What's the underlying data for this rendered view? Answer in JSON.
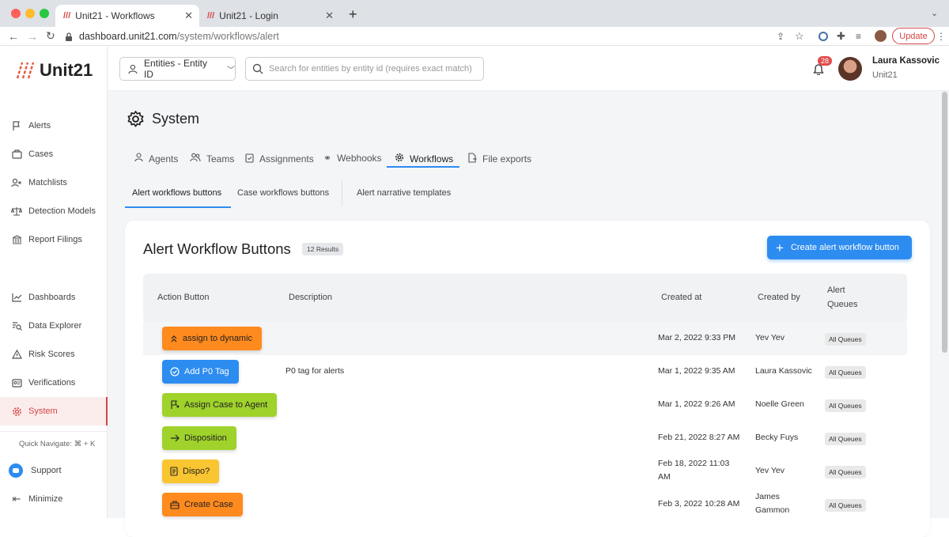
{
  "colors": {
    "accent": "#2d8cf0",
    "brand": "#d64545",
    "orange": "#ff8a1e",
    "blue": "#2d8cf0",
    "green": "#9fd22b",
    "yellow": "#f9c531"
  },
  "browser": {
    "tabs": [
      {
        "title": "Unit21 - Workflows",
        "active": true
      },
      {
        "title": "Unit21 - Login",
        "active": false
      }
    ],
    "url_host": "dashboard.unit21.com",
    "url_path": "/system/workflows/alert",
    "update_label": "Update"
  },
  "sidebar": {
    "logo": "Unit21",
    "items": [
      {
        "label": "Alerts",
        "icon": "flag-icon"
      },
      {
        "label": "Cases",
        "icon": "briefcase-icon"
      },
      {
        "label": "Matchlists",
        "icon": "user-plus-icon"
      },
      {
        "label": "Detection Models",
        "icon": "scale-icon"
      },
      {
        "label": "Report Filings",
        "icon": "bank-icon"
      },
      {
        "label": "Dashboards",
        "icon": "chart-line-icon"
      },
      {
        "label": "Data Explorer",
        "icon": "search-doc-icon"
      },
      {
        "label": "Risk Scores",
        "icon": "warning-icon"
      },
      {
        "label": "Verifications",
        "icon": "id-card-icon"
      },
      {
        "label": "System",
        "icon": "gear-icon",
        "active": true
      }
    ],
    "quick_navigate": "Quick Navigate: ⌘ + K",
    "support": "Support",
    "minimize": "Minimize"
  },
  "topbar": {
    "entity_selector": "Entities - Entity ID",
    "search_placeholder": "Search for entities by entity id (requires exact match)",
    "notification_count": "28",
    "user_name": "Laura Kassovic",
    "user_org": "Unit21"
  },
  "page": {
    "title": "System",
    "tabs": [
      {
        "label": "Agents"
      },
      {
        "label": "Teams"
      },
      {
        "label": "Assignments"
      },
      {
        "label": "Webhooks"
      },
      {
        "label": "Workflows",
        "active": true
      },
      {
        "label": "File exports"
      }
    ],
    "subtabs": [
      {
        "label": "Alert workflows buttons",
        "active": true
      },
      {
        "label": "Case workflows buttons"
      },
      {
        "label": "Alert narrative templates"
      }
    ]
  },
  "card": {
    "title": "Alert Workflow Buttons",
    "results": "12 Results",
    "create_label": "Create alert workflow button",
    "columns": {
      "action": "Action Button",
      "description": "Description",
      "created_at": "Created at",
      "created_by": "Created by",
      "queues_1": "Alert",
      "queues_2": "Queues"
    },
    "rows": [
      {
        "label": "assign to dynamic",
        "color": "orange",
        "icon": "double-chevron-up-icon",
        "description": "",
        "created_at": "Mar 2, 2022 9:33 PM",
        "created_by": "Yev Yev",
        "queues": "All Queues"
      },
      {
        "label": "Add P0 Tag",
        "color": "blue",
        "icon": "check-circle-icon",
        "description": "P0 tag for alerts",
        "created_at": "Mar 1, 2022 9:35 AM",
        "created_by": "Laura Kassovic",
        "queues": "All Queues"
      },
      {
        "label": "Assign Case to Agent",
        "color": "green",
        "icon": "flag-assign-icon",
        "description": "",
        "created_at": "Mar 1, 2022 9:26 AM",
        "created_by": "Noelle Green",
        "queues": "All Queues"
      },
      {
        "label": "Disposition",
        "color": "green",
        "icon": "arrow-right-icon",
        "description": "",
        "created_at": "Feb 21, 2022 8:27 AM",
        "created_by": "Becky Fuys",
        "queues": "All Queues"
      },
      {
        "label": "Dispo?",
        "color": "yellow",
        "icon": "document-icon",
        "description": "",
        "created_at_1": "Feb 18, 2022 11:03",
        "created_at_2": "AM",
        "created_by": "Yev Yev",
        "queues": "All Queues"
      },
      {
        "label": "Create Case",
        "color": "orange",
        "icon": "briefcase-icon",
        "description": "",
        "created_at": "Feb 3, 2022 10:28 AM",
        "created_by_1": "James",
        "created_by_2": "Gammon",
        "queues": "All Queues"
      }
    ]
  }
}
